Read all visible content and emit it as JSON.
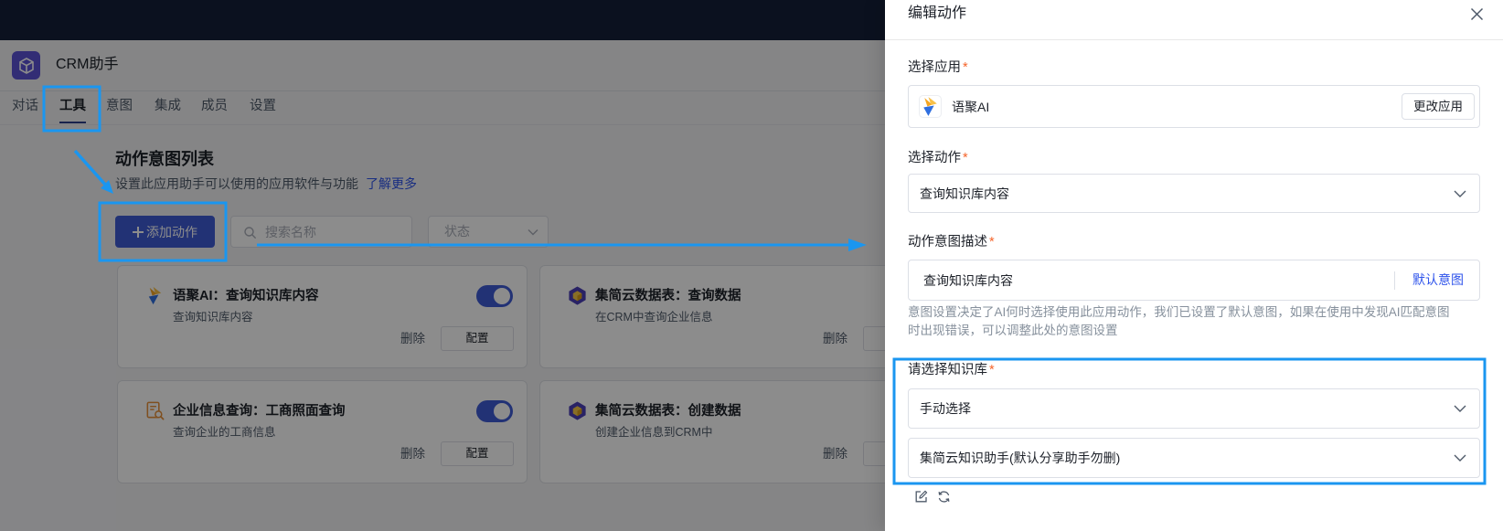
{
  "header": {
    "app_name": "CRM助手",
    "app_icon": "cube-icon"
  },
  "tabs": [
    {
      "label": "对话"
    },
    {
      "label": "工具",
      "active": true
    },
    {
      "label": "意图"
    },
    {
      "label": "集成"
    },
    {
      "label": "成员"
    },
    {
      "label": "设置"
    }
  ],
  "section": {
    "title": "动作意图列表",
    "subtitle": "设置此应用助手可以使用的应用软件与功能",
    "learn_more": "了解更多"
  },
  "toolbar": {
    "add_icon": "plus-icon",
    "add_label": "添加动作",
    "search_placeholder": "搜索名称",
    "status_placeholder": "状态"
  },
  "cards": [
    {
      "icon": "yuju-ai-logo-icon",
      "title": "语聚AI：查询知识库内容",
      "desc": "查询知识库内容",
      "enabled": true,
      "delete_label": "删除",
      "config_label": "配置"
    },
    {
      "icon": "jijianyun-table-logo-icon",
      "title": "集简云数据表：查询数据",
      "desc": "在CRM中查询企业信息",
      "delete_label": "删除"
    },
    {
      "icon": "company-info-search-icon",
      "title": "企业信息查询：工商照面查询",
      "desc": "查询企业的工商信息",
      "enabled": true,
      "delete_label": "删除",
      "config_label": "配置"
    },
    {
      "icon": "jijianyun-table-logo-icon",
      "title": "集简云数据表：创建数据",
      "desc": "创建企业信息到CRM中",
      "delete_label": "删除"
    }
  ],
  "drawer": {
    "title": "编辑动作",
    "required_mark": "*",
    "app": {
      "label": "选择应用",
      "value": "语聚AI",
      "icon": "yuju-ai-logo-icon",
      "change_label": "更改应用"
    },
    "action": {
      "label": "选择动作",
      "value": "查询知识库内容"
    },
    "intent": {
      "label": "动作意图描述",
      "value": "查询知识库内容",
      "default_label": "默认意图",
      "help_lines": [
        "意图设置决定了AI何时选择使用此应用动作，我们已设置了默认意图，如果在使用中发现AI匹配意图",
        "时出现错误，可以调整此处的意图设置"
      ]
    },
    "knowledge_base": {
      "label": "请选择知识库",
      "mode": "手动选择",
      "value": "集简云知识助手(默认分享助手勿删)"
    },
    "tools": [
      "edit-icon",
      "refresh-icon"
    ]
  },
  "colors": {
    "accent": "#3e5bd6",
    "link": "#2f54eb",
    "required": "#f5642a",
    "annotation": "#1a96f0",
    "topbar": "#14203a"
  }
}
